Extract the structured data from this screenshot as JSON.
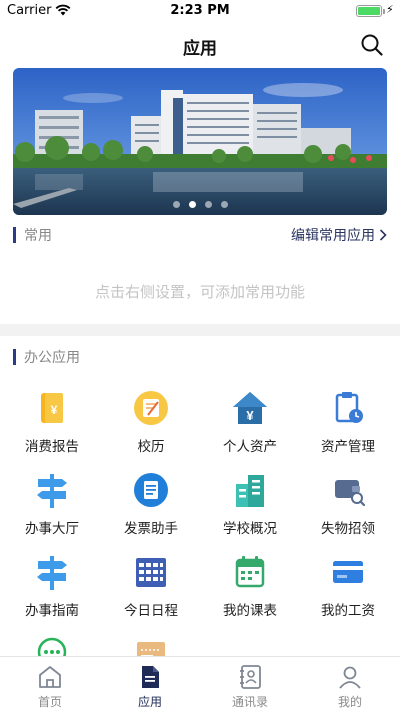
{
  "status_bar": {
    "carrier": "Carrier",
    "time": "2:23 PM"
  },
  "nav": {
    "title": "应用"
  },
  "banner": {
    "slide_count": 4,
    "active_slide": 2
  },
  "common": {
    "title": "常用",
    "edit_label": "编辑常用应用",
    "empty_hint": "点击右侧设置，可添加常用功能"
  },
  "office": {
    "title": "办公应用",
    "apps": [
      {
        "label": "消费报告",
        "icon": "report-icon"
      },
      {
        "label": "校历",
        "icon": "calendar-note-icon"
      },
      {
        "label": "个人资产",
        "icon": "house-yuan-icon"
      },
      {
        "label": "资产管理",
        "icon": "clipboard-clock-icon"
      },
      {
        "label": "办事大厅",
        "icon": "signpost-icon"
      },
      {
        "label": "发票助手",
        "icon": "invoice-icon"
      },
      {
        "label": "学校概况",
        "icon": "buildings-icon"
      },
      {
        "label": "失物招领",
        "icon": "wallet-search-icon"
      },
      {
        "label": "办事指南",
        "icon": "signpost-icon"
      },
      {
        "label": "今日日程",
        "icon": "schedule-grid-icon"
      },
      {
        "label": "我的课表",
        "icon": "timetable-icon"
      },
      {
        "label": "我的工资",
        "icon": "card-icon"
      },
      {
        "label": "",
        "icon": "chat-bubble-icon"
      },
      {
        "label": "",
        "icon": "ticket-icon"
      }
    ]
  },
  "tabs": [
    {
      "label": "首页",
      "icon": "home-icon",
      "active": false
    },
    {
      "label": "应用",
      "icon": "document-icon",
      "active": true
    },
    {
      "label": "通讯录",
      "icon": "contacts-icon",
      "active": false
    },
    {
      "label": "我的",
      "icon": "person-icon",
      "active": false
    }
  ],
  "colors": {
    "accent": "#2a3c84",
    "section_bar": "#2a3c84",
    "hint": "#c4c4c4",
    "tab_active": "#1e2b56"
  }
}
